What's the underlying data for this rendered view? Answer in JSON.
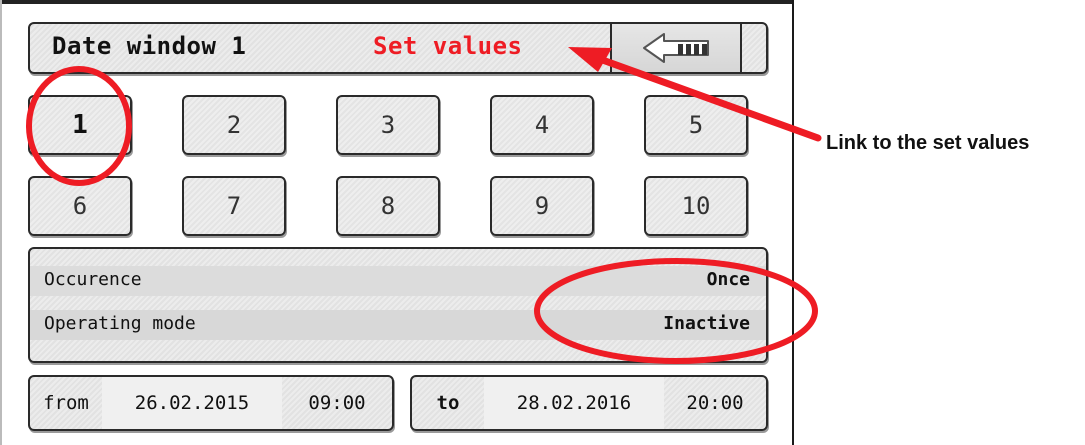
{
  "header": {
    "title": "Date window 1",
    "set_values_link": "Set values",
    "back_button_icon": "back-arrow-icon"
  },
  "window_buttons": [
    "1",
    "2",
    "3",
    "4",
    "5",
    "6",
    "7",
    "8",
    "9",
    "10"
  ],
  "selected_window": "1",
  "settings": [
    {
      "label": "Occurence",
      "value": "Once"
    },
    {
      "label": "Operating mode",
      "value": "Inactive"
    }
  ],
  "from": {
    "label": "from",
    "date": "26.02.2015",
    "time": "09:00"
  },
  "to": {
    "label": "to",
    "date": "28.02.2016",
    "time": "20:00"
  },
  "annotation": {
    "text": "Link to the set values",
    "color": "#ee1c24"
  },
  "colors": {
    "accent": "#ee1c24"
  }
}
